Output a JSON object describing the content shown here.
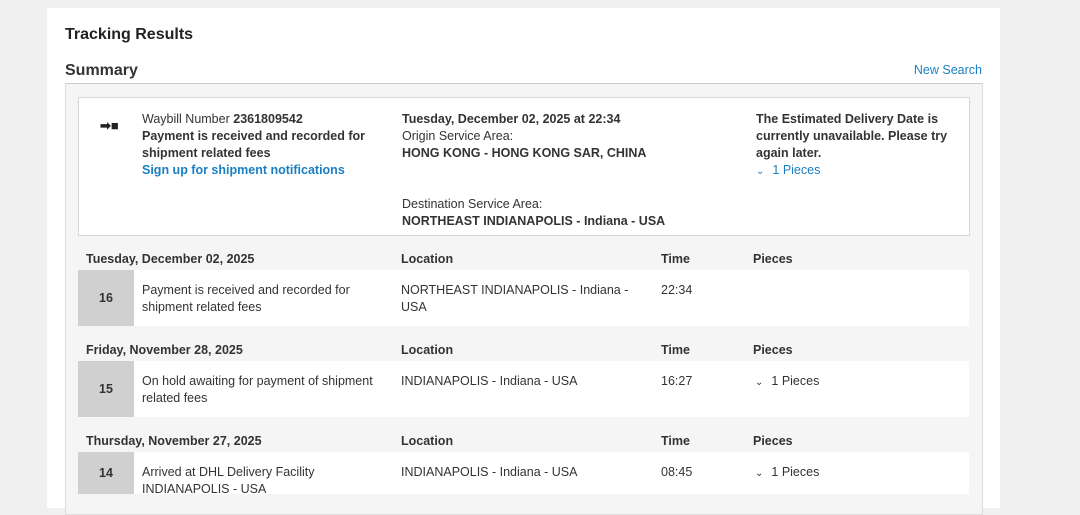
{
  "header": {
    "title": "Tracking Results",
    "summary": "Summary",
    "new_search": "New Search"
  },
  "summary": {
    "waybill_label": "Waybill Number",
    "waybill_number": "2361809542",
    "status_line1": "Payment is received and recorded for",
    "status_line2": "shipment related fees",
    "signup": "Sign up for shipment notifications",
    "datetime": "Tuesday, December 02, 2025 at 22:34",
    "origin_label": "Origin Service Area:",
    "origin": "HONG KONG - HONG KONG SAR, CHINA",
    "dest_label": "Destination Service Area:",
    "dest": "NORTHEAST INDIANAPOLIS - Indiana - USA",
    "edd_line1": "The Estimated Delivery Date is",
    "edd_line2": "currently unavailable. Please try",
    "edd_line3": "again later.",
    "pieces": "1 Pieces"
  },
  "columns": {
    "location": "Location",
    "time": "Time",
    "pieces": "Pieces"
  },
  "days": [
    {
      "date": "Tuesday, December 02, 2025",
      "event": {
        "num": "16",
        "desc1": "Payment is received and recorded for",
        "desc2": "shipment related fees",
        "loc1": "NORTHEAST INDIANAPOLIS - Indiana -",
        "loc2": "USA",
        "time": "22:34",
        "pieces": ""
      }
    },
    {
      "date": "Friday, November 28, 2025",
      "event": {
        "num": "15",
        "desc1": "On hold awaiting for payment of shipment",
        "desc2": "related fees",
        "loc1": "INDIANAPOLIS - Indiana - USA",
        "loc2": "",
        "time": "16:27",
        "pieces": "1 Pieces"
      }
    },
    {
      "date": "Thursday, November 27, 2025",
      "event": {
        "num": "14",
        "desc1": "Arrived at DHL Delivery Facility",
        "desc2": "INDIANAPOLIS - USA",
        "loc1": "INDIANAPOLIS - Indiana - USA",
        "loc2": "",
        "time": "08:45",
        "pieces": "1 Pieces"
      }
    }
  ]
}
